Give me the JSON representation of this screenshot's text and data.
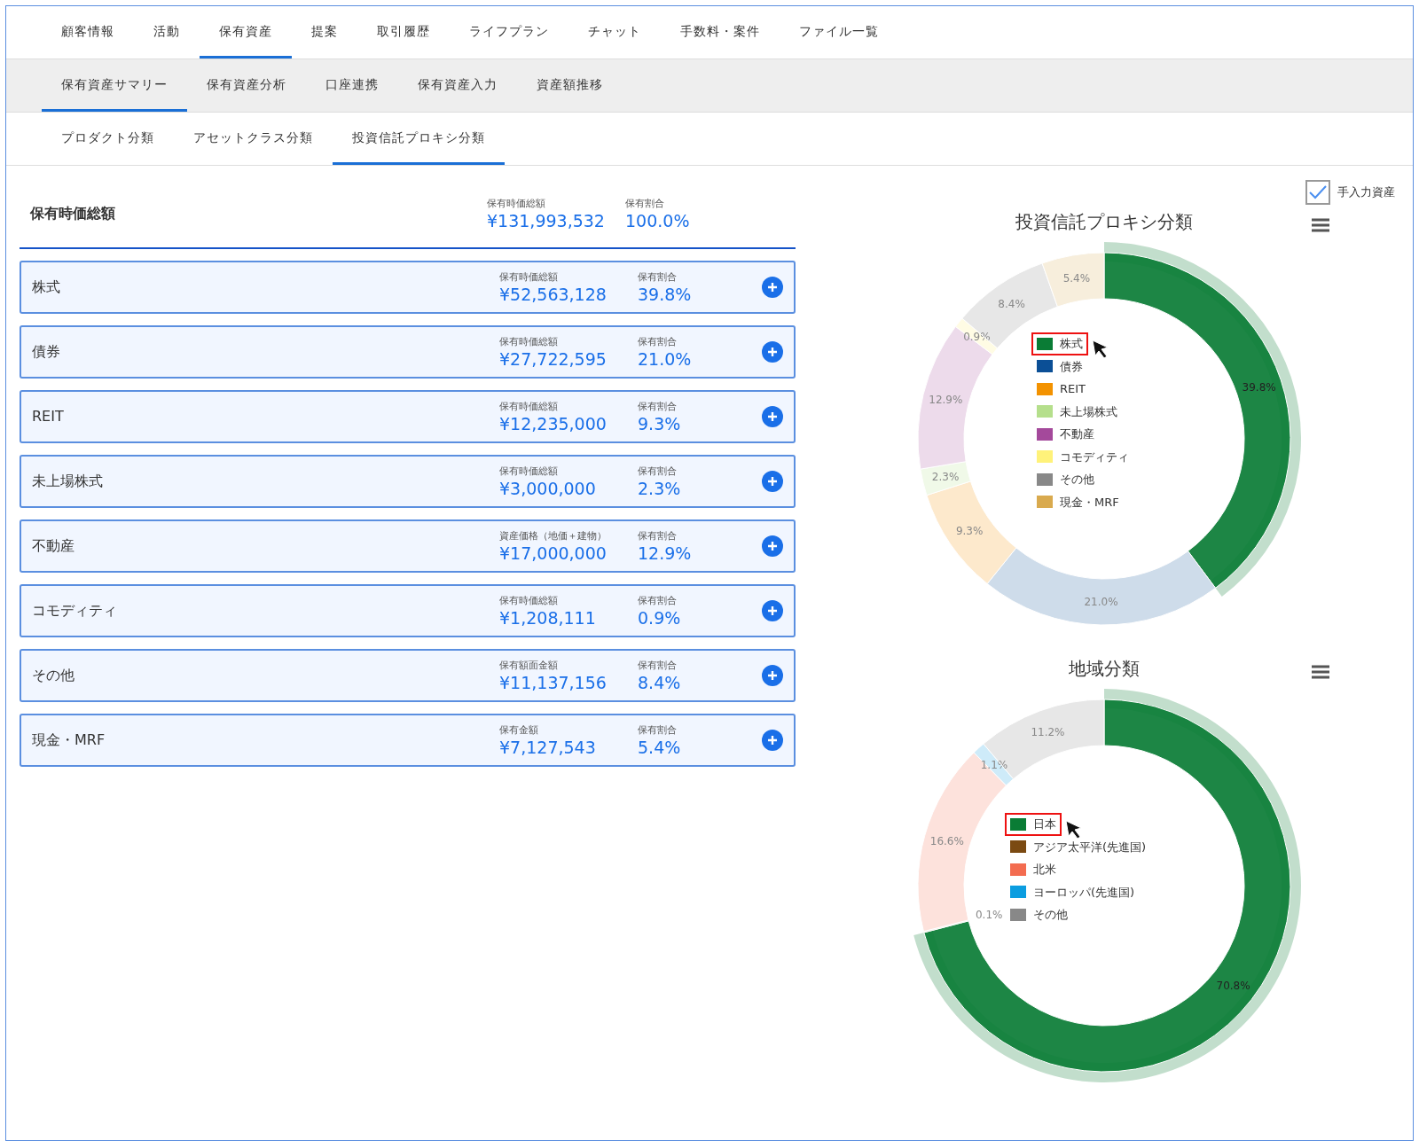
{
  "main_tabs": [
    {
      "label": "顧客情報",
      "selected": false
    },
    {
      "label": "活動",
      "selected": false
    },
    {
      "label": "保有資産",
      "selected": true
    },
    {
      "label": "提案",
      "selected": false
    },
    {
      "label": "取引履歴",
      "selected": false
    },
    {
      "label": "ライフプラン",
      "selected": false
    },
    {
      "label": "チャット",
      "selected": false
    },
    {
      "label": "手数料・案件",
      "selected": false
    },
    {
      "label": "ファイル一覧",
      "selected": false
    }
  ],
  "sub_tabs": [
    {
      "label": "保有資産サマリー",
      "selected": true
    },
    {
      "label": "保有資産分析",
      "selected": false
    },
    {
      "label": "口座連携",
      "selected": false
    },
    {
      "label": "保有資産入力",
      "selected": false
    },
    {
      "label": "資産額推移",
      "selected": false
    }
  ],
  "class_tabs": [
    {
      "label": "プロダクト分類",
      "selected": false
    },
    {
      "label": "アセットクラス分類",
      "selected": false
    },
    {
      "label": "投資信託プロキシ分類",
      "selected": true
    }
  ],
  "summary": {
    "label": "保有時価総額",
    "amount_caption": "保有時価総額",
    "amount": "¥131,993,532",
    "ratio_caption": "保有割合",
    "ratio": "100.0%"
  },
  "rows": [
    {
      "name": "株式",
      "amount_caption": "保有時価総額",
      "amount": "¥52,563,128",
      "ratio_caption": "保有割合",
      "ratio": "39.8%"
    },
    {
      "name": "債券",
      "amount_caption": "保有時価総額",
      "amount": "¥27,722,595",
      "ratio_caption": "保有割合",
      "ratio": "21.0%"
    },
    {
      "name": "REIT",
      "amount_caption": "保有時価総額",
      "amount": "¥12,235,000",
      "ratio_caption": "保有割合",
      "ratio": "9.3%"
    },
    {
      "name": "未上場株式",
      "amount_caption": "保有時価総額",
      "amount": "¥3,000,000",
      "ratio_caption": "保有割合",
      "ratio": "2.3%"
    },
    {
      "name": "不動産",
      "amount_caption": "資産価格（地価＋建物）",
      "amount": "¥17,000,000",
      "ratio_caption": "保有割合",
      "ratio": "12.9%"
    },
    {
      "name": "コモディティ",
      "amount_caption": "保有時価総額",
      "amount": "¥1,208,111",
      "ratio_caption": "保有割合",
      "ratio": "0.9%"
    },
    {
      "name": "その他",
      "amount_caption": "保有額面金額",
      "amount": "¥11,137,156",
      "ratio_caption": "保有割合",
      "ratio": "8.4%"
    },
    {
      "name": "現金・MRF",
      "amount_caption": "保有金額",
      "amount": "¥7,127,543",
      "ratio_caption": "保有割合",
      "ratio": "5.4%"
    }
  ],
  "manual_assets": {
    "label": "手入力資産",
    "checked": true
  },
  "charts": [
    {
      "title": "投資信託プロキシ分類",
      "slices": [
        {
          "color": "#0a7c35",
          "selected": true
        },
        {
          "color": "#0b4f96",
          "selected": false
        },
        {
          "color": "#f39200",
          "selected": false
        },
        {
          "color": "#b5df8c",
          "selected": false
        },
        {
          "color": "#a4499b",
          "selected": false
        },
        {
          "color": "#fff27a",
          "selected": false
        },
        {
          "color": "#888888",
          "selected": false
        },
        {
          "color": "#d9aa4e",
          "selected": false
        }
      ],
      "chart_data": {
        "type": "donut",
        "legend": "center",
        "categories": [
          "株式",
          "債券",
          "REIT",
          "未上場株式",
          "不動産",
          "コモディティ",
          "その他",
          "現金・MRF"
        ],
        "values": [
          39.8,
          21.0,
          9.3,
          2.3,
          12.9,
          0.9,
          8.4,
          5.4
        ],
        "value_labels": [
          "39.8%",
          "21.0%",
          "9.3%",
          "2.3%",
          "12.9%",
          "0.9%",
          "8.4%",
          "5.4%"
        ]
      }
    },
    {
      "title": "地域分類",
      "slices": [
        {
          "color": "#0a7c35",
          "selected": true
        },
        {
          "color": "#7b4a12",
          "selected": false
        },
        {
          "color": "#f36c50",
          "selected": false
        },
        {
          "color": "#0b9de0",
          "selected": false
        },
        {
          "color": "#888888",
          "selected": false
        }
      ],
      "chart_data": {
        "type": "donut",
        "legend": "center",
        "categories": [
          "日本",
          "アジア太平洋(先進国)",
          "北米",
          "ヨーロッパ(先進国)",
          "その他"
        ],
        "values": [
          70.8,
          0.1,
          16.6,
          1.1,
          11.2
        ],
        "value_labels": [
          "70.8%",
          "0.1%",
          "16.6%",
          "1.1%",
          "11.2%"
        ]
      }
    }
  ]
}
